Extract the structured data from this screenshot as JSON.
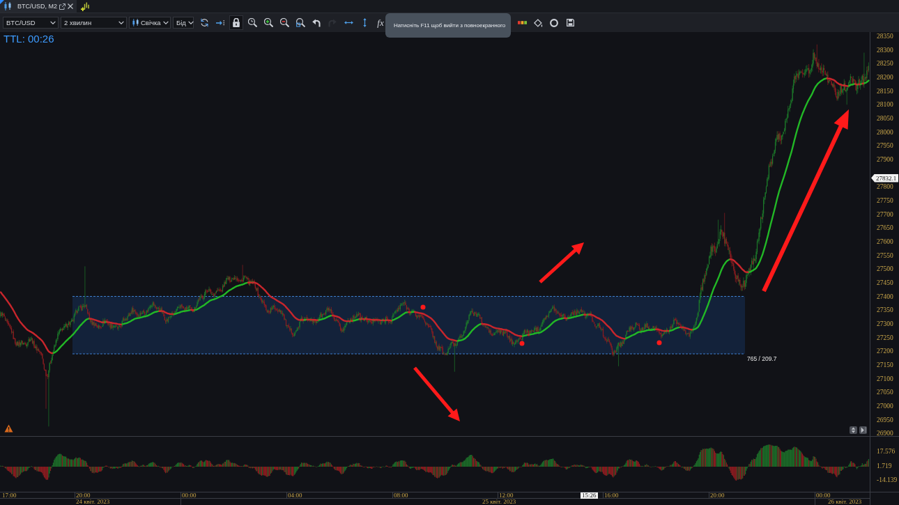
{
  "tabs": [
    {
      "label": "BTC/USD, M2",
      "selected": true
    }
  ],
  "toolbar": {
    "dropdowns": [
      {
        "kind": "symbol",
        "value": "BTC/USD"
      },
      {
        "kind": "timeframe",
        "value": "2 хвилин"
      },
      {
        "kind": "chart_type",
        "value": "Свічка"
      },
      {
        "kind": "price_side",
        "value": "Бід"
      }
    ],
    "buttons": [
      {
        "kind": "refresh",
        "on": false,
        "disabled": false
      },
      {
        "kind": "scroll_end",
        "on": false,
        "disabled": false
      },
      {
        "kind": "lock",
        "on": true,
        "disabled": false
      },
      {
        "kind": "time_zoom",
        "on": false,
        "disabled": false
      },
      {
        "kind": "zoom_in",
        "on": false,
        "disabled": false
      },
      {
        "kind": "zoom_out",
        "on": false,
        "disabled": false
      },
      {
        "kind": "zoom_fit",
        "on": false,
        "disabled": false
      },
      {
        "kind": "undo",
        "on": false,
        "disabled": false
      },
      {
        "kind": "redo",
        "on": false,
        "disabled": true
      },
      {
        "kind": "fit_width",
        "on": false,
        "disabled": false
      },
      {
        "kind": "fit_height",
        "on": false,
        "disabled": false
      },
      {
        "kind": "formula",
        "label": "fx",
        "on": false,
        "disabled": false
      }
    ],
    "right_buttons": [
      {
        "kind": "colors",
        "on": false,
        "disabled": false
      },
      {
        "kind": "paint",
        "on": false,
        "disabled": false
      },
      {
        "kind": "ring",
        "on": false,
        "disabled": false
      },
      {
        "kind": "save",
        "on": false,
        "disabled": false
      }
    ],
    "tooltip": "Натисніть F11 щоб вийти з повноекранного"
  },
  "chart": {
    "ttl": "TTL: 00:26",
    "price_axis": [
      "28350",
      "28300",
      "28250",
      "28200",
      "28150",
      "28100",
      "28050",
      "28000",
      "27950",
      "27900",
      "27800",
      "27750",
      "27700",
      "27650",
      "27600",
      "27550",
      "27500",
      "27450",
      "27400",
      "27350",
      "27300",
      "27250",
      "27200",
      "27150",
      "27100",
      "27050",
      "27000",
      "26950",
      "26900"
    ],
    "price_tag": "27832.1",
    "range_box": {
      "label": "765 / 209.7"
    },
    "oscillator_axis": [
      "17.576",
      "1.719",
      "-14.139"
    ],
    "time_axis": [
      "17:00",
      "20:00",
      "00:00",
      "04:00",
      "08:00",
      "12:00",
      "16:00",
      "20:00",
      "00:00"
    ],
    "cursor_time": "15:26",
    "date_axis": [
      "24 квіт. 2023",
      "25 квіт. 2023",
      "26 квіт. 2023"
    ]
  }
}
